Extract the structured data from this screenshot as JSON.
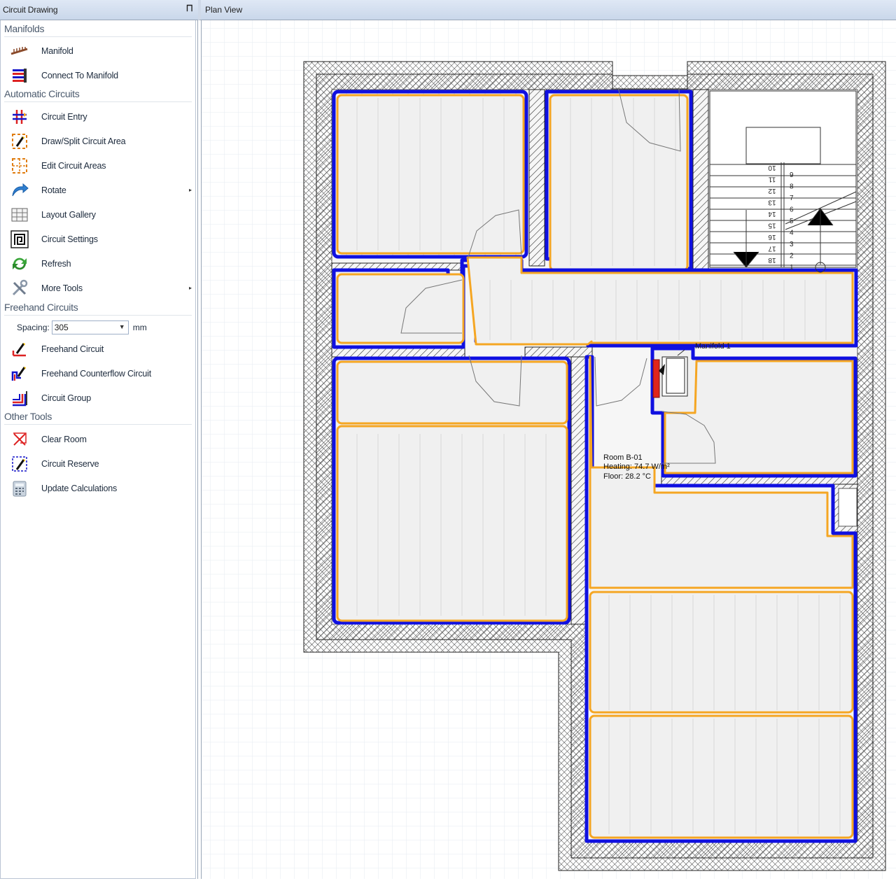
{
  "panel": {
    "title": "Circuit Drawing",
    "pin_icon": "pin-icon",
    "groups": {
      "manifolds": "Manifolds",
      "automatic": "Automatic Circuits",
      "freehand": "Freehand Circuits",
      "other": "Other Tools"
    },
    "tools": {
      "manifold": "Manifold",
      "connect": "Connect To Manifold",
      "circuit_entry": "Circuit Entry",
      "draw_split": "Draw/Split Circuit Area",
      "edit_areas": "Edit Circuit Areas",
      "rotate": "Rotate",
      "layout_gallery": "Layout Gallery",
      "circuit_settings": "Circuit Settings",
      "refresh": "Refresh",
      "more_tools": "More Tools",
      "freehand_circuit": "Freehand Circuit",
      "freehand_counterflow": "Freehand Counterflow Circuit",
      "circuit_group": "Circuit Group",
      "clear_room": "Clear Room",
      "circuit_reserve": "Circuit Reserve",
      "update_calc": "Update Calculations"
    },
    "spacing": {
      "label": "Spacing:",
      "value": "305",
      "unit": "mm"
    }
  },
  "plan": {
    "title": "Plan View",
    "room": {
      "name": "Room B-01",
      "heating": "Heating: 74.7 W/m²",
      "floor": "Floor: 28.2 °C"
    },
    "manifold_label": "Manifold 1",
    "stair_left_numbers": [
      "10",
      "11",
      "12",
      "13",
      "14",
      "15",
      "16",
      "17",
      "18"
    ],
    "stair_right_numbers": [
      "9",
      "8",
      "7",
      "6",
      "5",
      "4",
      "3",
      "2",
      "1"
    ],
    "colors": {
      "circuit_outer": "#1010e0",
      "circuit_inner": "#f5a623",
      "manifold": "#e0251b",
      "room_fill": "#f0f0f0"
    }
  }
}
